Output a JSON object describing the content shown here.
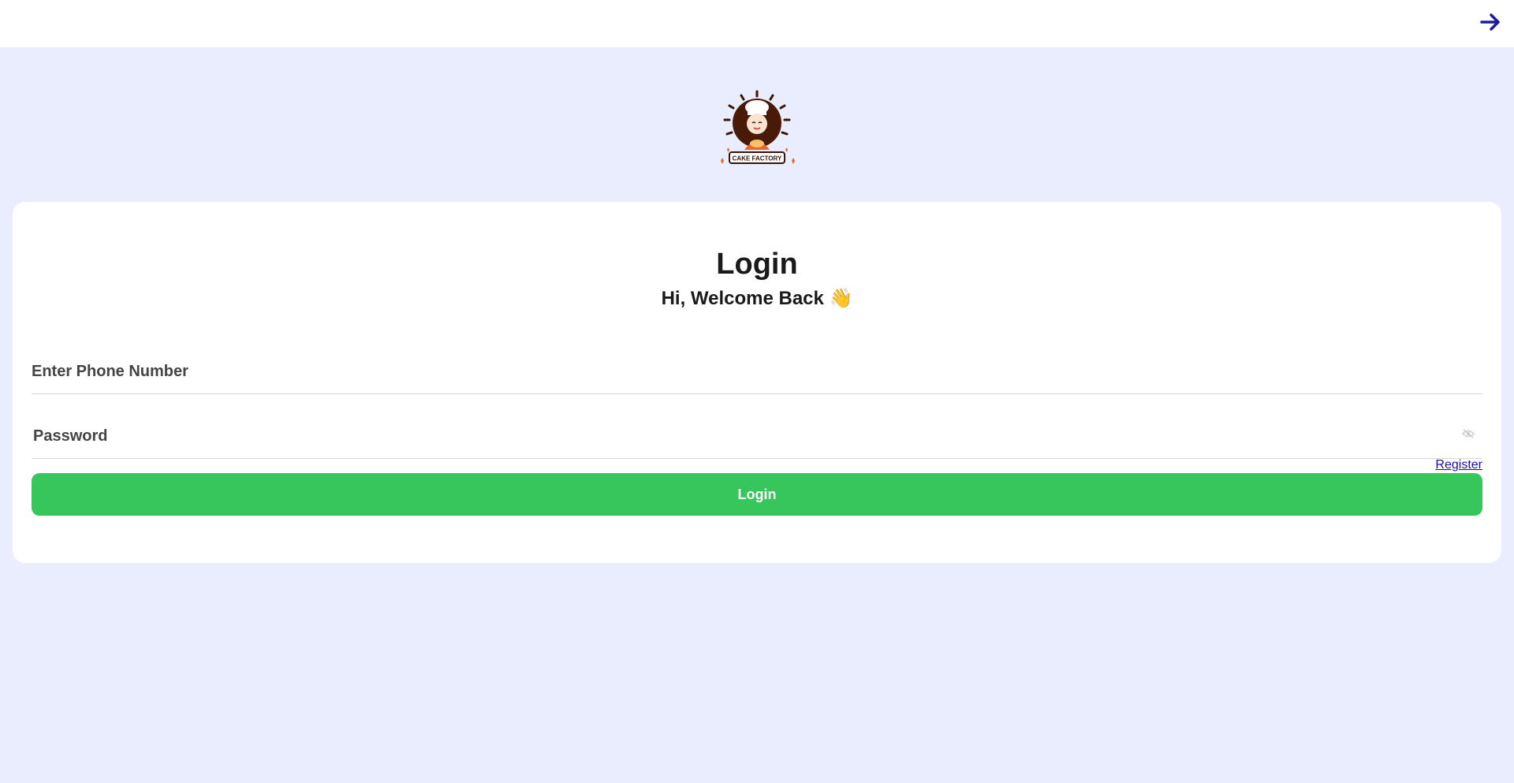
{
  "header": {
    "nav_icon": "arrow-right-icon"
  },
  "logo": {
    "text": "CAKE FACTORY"
  },
  "login": {
    "title": "Login",
    "subtitle": "Hi, Welcome Back 👋",
    "phone_placeholder": "Enter Phone Number",
    "phone_value": "",
    "password_placeholder": "Password",
    "password_value": "",
    "password_toggle_icon": "eye-slash-icon",
    "register_label": "Register",
    "submit_label": "Login"
  },
  "colors": {
    "page_background": "#e9edfd",
    "accent_green": "#37c65c",
    "link_blue": "#1a0dab",
    "arrow_navy": "#1b1b9e"
  }
}
